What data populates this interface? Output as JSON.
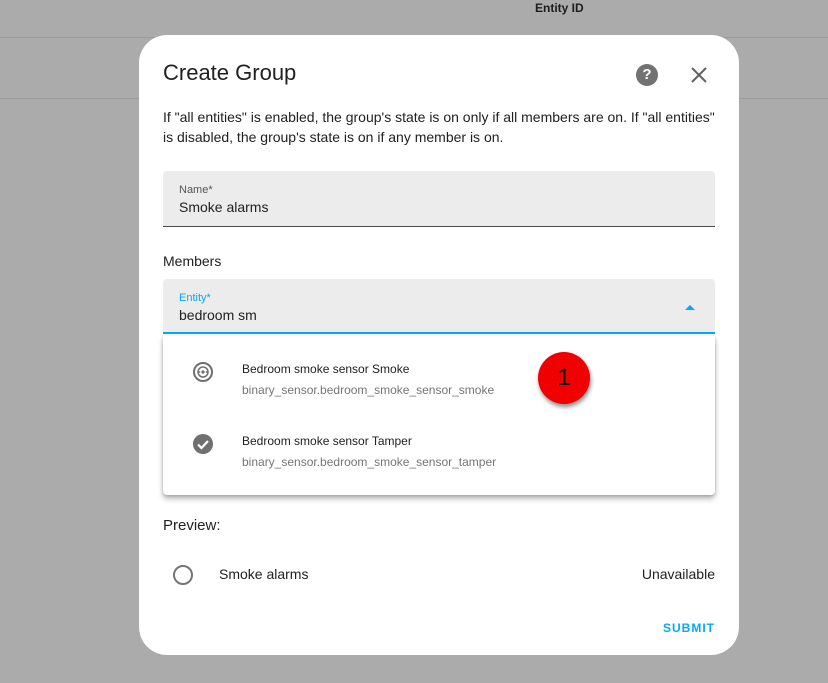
{
  "background": {
    "column_header": "Entity ID"
  },
  "dialog": {
    "title": "Create Group",
    "help_icon": "help-circle-icon",
    "close_icon": "close-icon",
    "description": "If \"all entities\" is enabled, the group's state is on only if all members are on. If \"all entities\" is disabled, the group's state is on if any member is on.",
    "name_field": {
      "label": "Name*",
      "value": "Smoke alarms"
    },
    "members_label": "Members",
    "entity_field": {
      "label": "Entity*",
      "value": "bedroom sm"
    },
    "options": [
      {
        "icon": "smoke-detector-icon",
        "primary": "Bedroom smoke sensor Smoke",
        "secondary": "binary_sensor.bedroom_smoke_sensor_smoke"
      },
      {
        "icon": "check-circle-icon",
        "primary": "Bedroom smoke sensor Tamper",
        "secondary": "binary_sensor.bedroom_smoke_sensor_tamper"
      }
    ],
    "badge": "1",
    "preview": {
      "label": "Preview:",
      "entity_name": "Smoke alarms",
      "state": "Unavailable"
    },
    "submit_label": "SUBMIT"
  },
  "colors": {
    "accent": "#03a9f4",
    "overlay": "#ababab",
    "badge": "#f00000"
  }
}
